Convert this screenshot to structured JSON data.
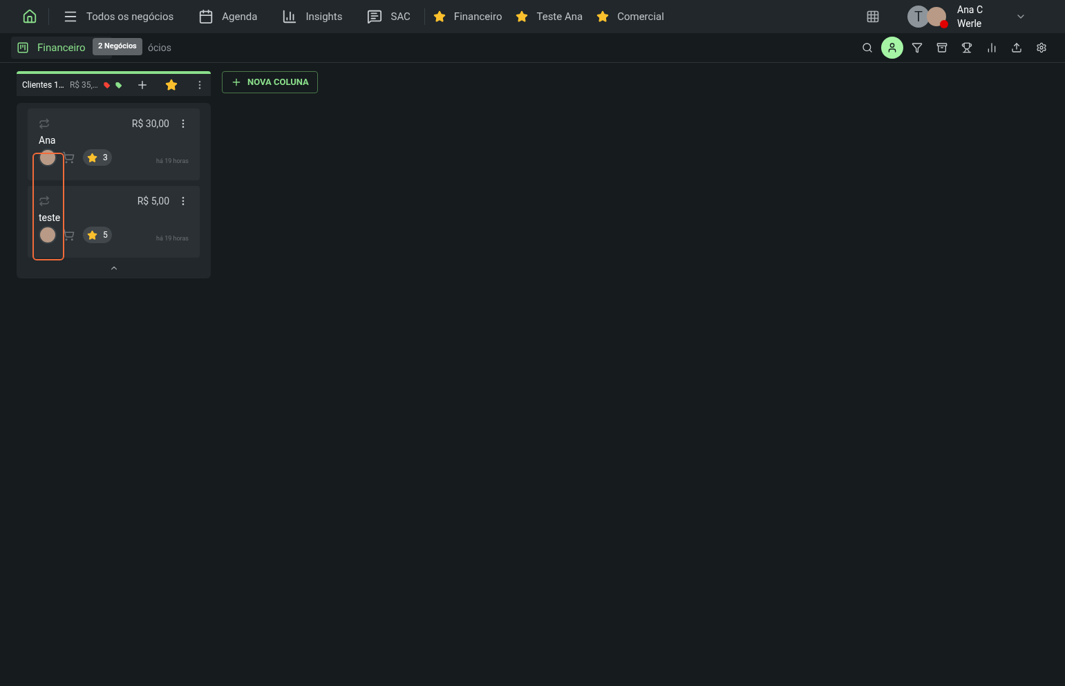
{
  "nav": {
    "items": [
      {
        "kind": "menu",
        "label": "Todos os negócios"
      },
      {
        "kind": "calendar",
        "label": "Agenda"
      },
      {
        "kind": "chart",
        "label": "Insights"
      },
      {
        "kind": "chat",
        "label": "SAC"
      },
      {
        "kind": "star",
        "label": "Financeiro"
      },
      {
        "kind": "star",
        "label": "Teste Ana"
      },
      {
        "kind": "star",
        "label": "Comercial"
      }
    ],
    "user": {
      "initial": "T",
      "name": "Ana C Werle"
    }
  },
  "board": {
    "tab": "Financeiro",
    "breadcrumb": "ócios",
    "tooltip": "2 Negócios"
  },
  "toolbar": [
    {
      "kind": "search",
      "selected": false
    },
    {
      "kind": "user",
      "selected": true
    },
    {
      "kind": "filter",
      "selected": false
    },
    {
      "kind": "archive",
      "selected": false
    },
    {
      "kind": "trophy",
      "selected": false
    },
    {
      "kind": "chart",
      "selected": false
    },
    {
      "kind": "upload",
      "selected": false
    },
    {
      "kind": "settings",
      "selected": false
    }
  ],
  "column": {
    "title": "Clientes 1…",
    "total": "R$ 35,…",
    "tags": [
      {
        "color": "#f44336"
      },
      {
        "color": "#8be08b"
      }
    ],
    "cards": [
      {
        "value": "R$ 30,00",
        "title": "Ana",
        "count": "3",
        "time": "há 19 horas"
      },
      {
        "value": "R$ 5,00",
        "title": "teste",
        "count": "5",
        "time": "há 19 horas"
      }
    ]
  },
  "new_column": "NOVA COLUNA"
}
